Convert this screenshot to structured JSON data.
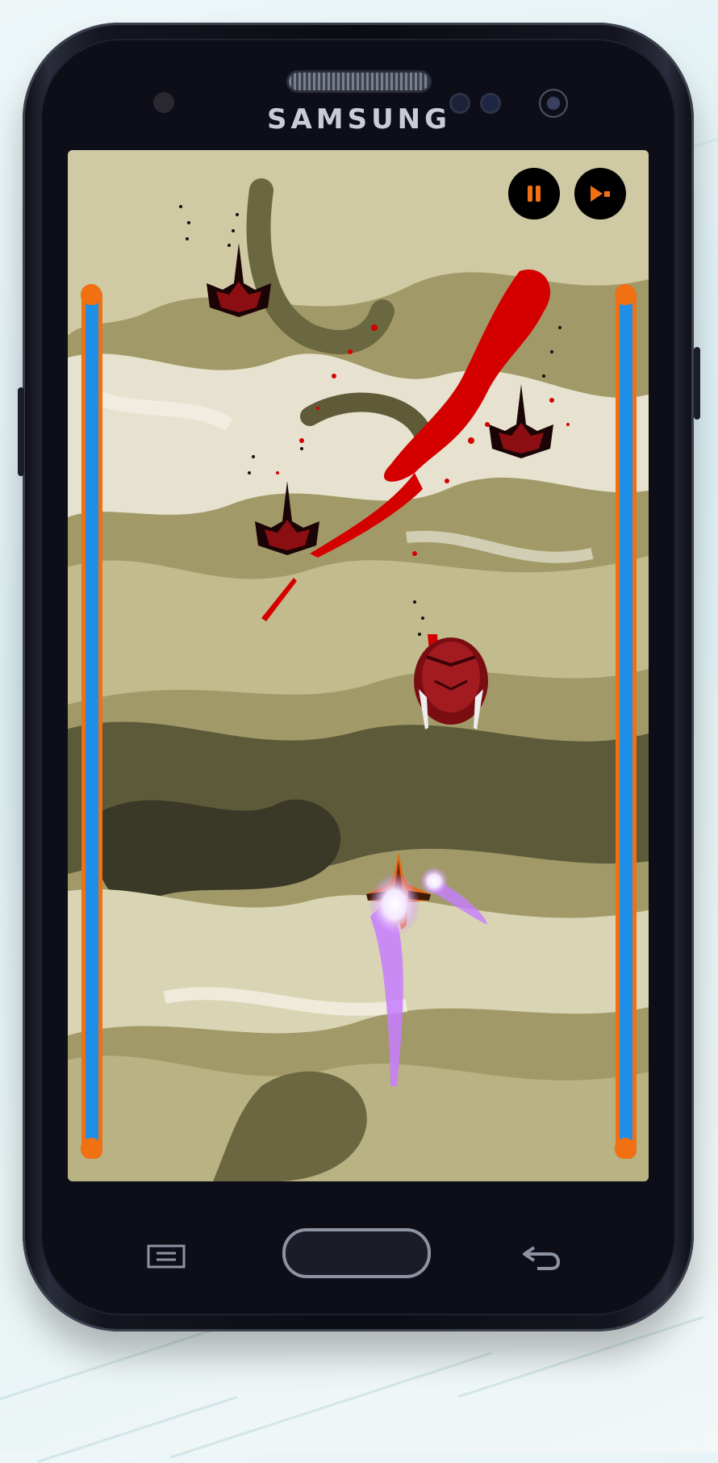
{
  "device": {
    "brand": "SAMSUNG"
  },
  "game": {
    "hud": {
      "pause_icon": "pause-icon",
      "mute_icon": "speaker-mute-icon"
    },
    "left_bar_level": 1.0,
    "right_bar_level": 1.0,
    "colors": {
      "bar_fill": "#1f8ee6",
      "bar_border": "#f07012",
      "blood": "#d40000",
      "plasma": "#c77dff"
    }
  },
  "nav": {
    "menu_icon": "menu-icon",
    "home_icon": "home-button",
    "back_icon": "back-arrow-icon"
  }
}
